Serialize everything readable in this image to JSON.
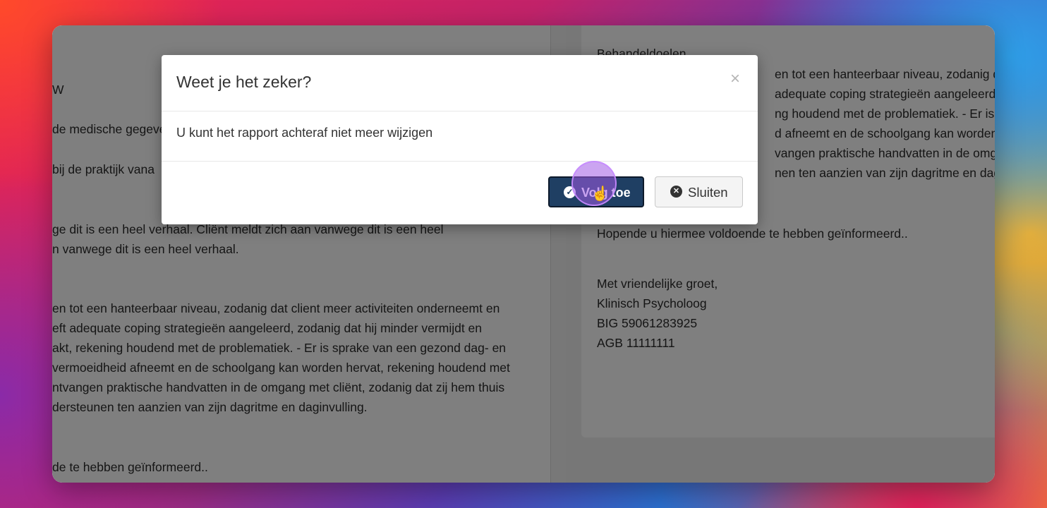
{
  "left_pane": {
    "lines": [
      "W",
      "de medische gegeve",
      "bij de praktijk vana",
      "ge dit is een heel verhaal.  Cliënt meldt zich aan vanwege dit is een heel",
      "n vanwege dit is een heel verhaal.",
      "en tot een hanteerbaar niveau, zodanig dat client meer activiteiten onderneemt en",
      "eft adequate coping strategieën aangeleerd, zodanig dat hij minder vermijdt en",
      "akt, rekening houdend met de problematiek. - Er is sprake van een gezond dag- en",
      "vermoeidheid afneemt en de schoolgang kan worden hervat, rekening houdend met",
      "ntvangen praktische handvatten in de omgang met cliënt, zodanig dat zij hem thuis",
      "dersteunen ten aanzien van zijn dagritme en daginvulling.",
      "de te hebben geïnformeerd.."
    ]
  },
  "right_pane": {
    "heading": "Behandeldoelen",
    "lines": [
      "en tot een hanteerbaar niveau, zodanig d",
      "adequate coping strategieën aangeleerd,",
      "ng houdend met de problematiek. - Er is s",
      "d afneemt en de schoolgang kan worden",
      "vangen praktische handvatten in de omga",
      "nen ten aanzien van zijn dagritme en dag"
    ],
    "closing_line": "Hopende u hiermee voldoende te hebben geïnformeerd..",
    "signature": [
      "Met vriendelijke groet,",
      "Klinisch Psycholoog",
      "BIG 59061283925",
      "AGB 11111111"
    ]
  },
  "modal": {
    "title": "Weet je het zeker?",
    "close_symbol": "×",
    "message": "U kunt het rapport achteraf niet meer wijzigen",
    "confirm_label": "Volg toe",
    "confirm_icon": "check-circle-icon",
    "confirm_icon_glyph": "✓",
    "close_label": "Sluiten",
    "close_icon": "times-circle-icon",
    "close_icon_glyph": "✕"
  },
  "colors": {
    "primary": "#1f3f63",
    "overlay": "rgba(0,0,0,0.5)",
    "cursor_highlight": "#a05ae6"
  }
}
